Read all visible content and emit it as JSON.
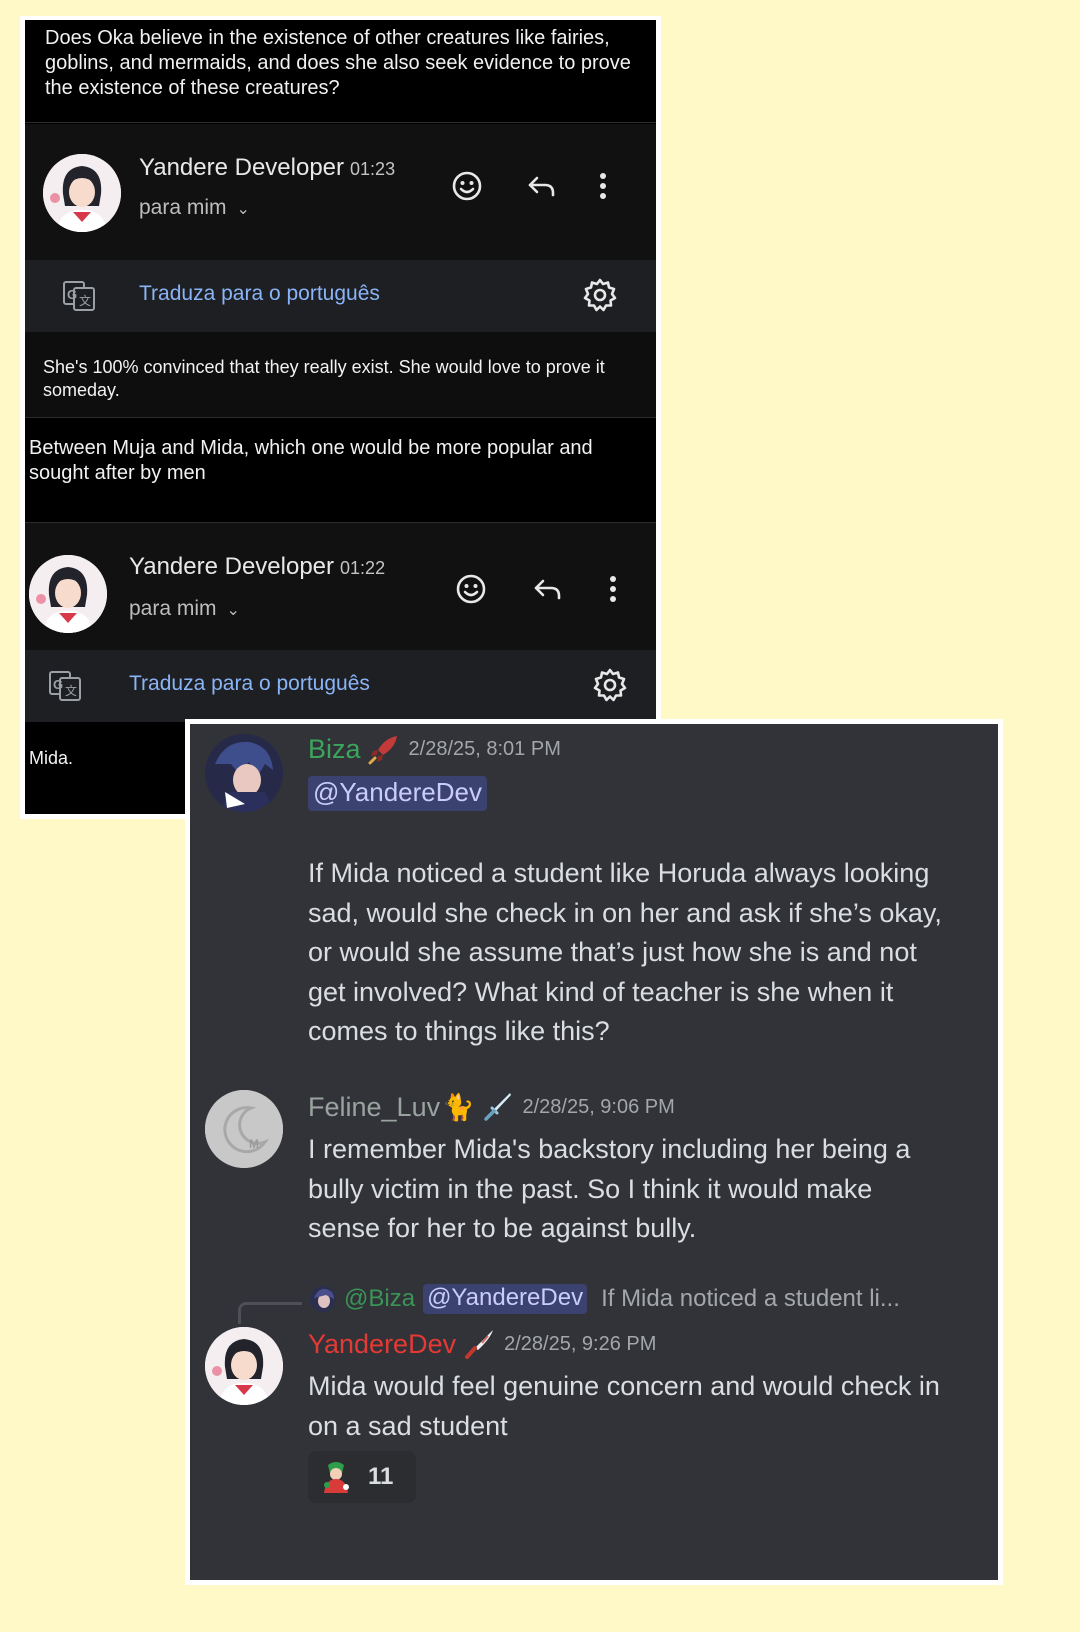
{
  "gmail": {
    "question1": "Does Oka believe in the existence of other creatures like fairies, goblins, and mermaids, and does she also seek evidence to prove the existence of these creatures?",
    "email1": {
      "sender": "Yandere Developer",
      "time": "01:23",
      "recipient": "para mim",
      "translate_label": "Traduza para o português",
      "body": "She's 100% convinced that they really exist. She would love to prove it someday."
    },
    "question2": "Between Muja and Mida, which one would be more popular and sought after by men",
    "email2": {
      "sender": "Yandere Developer",
      "time": "01:22",
      "recipient": "para mim",
      "translate_label": "Traduza para o português",
      "body": "Mida."
    },
    "icons": [
      "emoji-icon",
      "reply-icon",
      "more-icon",
      "google-translate-icon",
      "settings-gear-icon"
    ]
  },
  "discord": {
    "messages": [
      {
        "author": "Biza",
        "author_color": "#3ba55c",
        "timestamp": "2/28/25, 8:01 PM",
        "mention": "@YandereDev",
        "text": "If Mida noticed a student like Horuda always looking sad, would she check in on her and ask if she’s okay, or would she assume that’s just how she is and not get involved? What kind of teacher is she when it comes to things like this?"
      },
      {
        "author": "Feline_Luv",
        "author_color": "#9aa3a0",
        "author_emoji": "🐈",
        "timestamp": "2/28/25, 9:06 PM",
        "text": "I remember Mida's backstory including her being a bully victim in the past. So I think it would make sense for her to be against bully."
      },
      {
        "reply_to": {
          "author": "@Biza",
          "mention": "@YandereDev",
          "snippet": "If Mida noticed a student li..."
        },
        "author": "YandereDev",
        "author_color": "#e53935",
        "timestamp": "2/28/25, 9:26 PM",
        "text": "Mida would feel genuine concern and would check in on a sad student",
        "reaction": {
          "count": "11"
        }
      }
    ]
  }
}
